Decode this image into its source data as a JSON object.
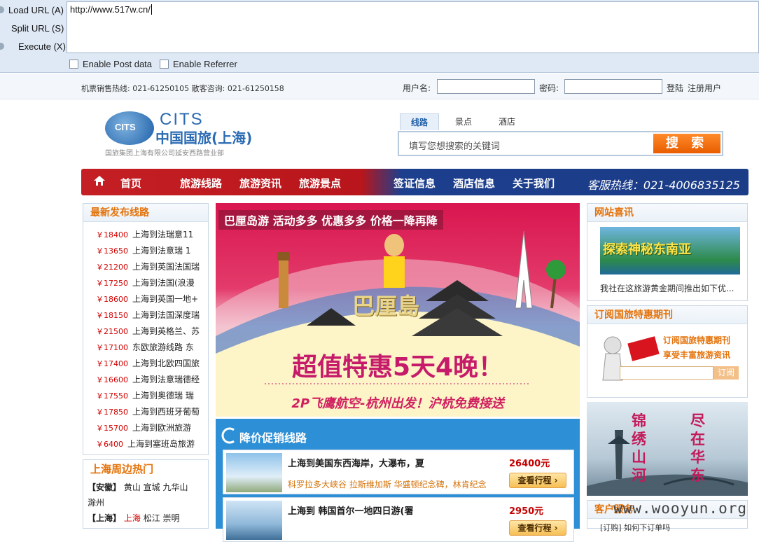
{
  "hackbar": {
    "load_url": "Load URL (A)",
    "split_url": "Split URL (S)",
    "execute": "Execute (X)",
    "url_value": "http://www.517w.cn/",
    "enable_post": "Enable Post data",
    "enable_referrer": "Enable Referrer"
  },
  "topbar": {
    "hotline": "机票销售热线: 021-61250105  散客咨询: 021-61250158",
    "username_label": "用户名:",
    "password_label": "密码:",
    "login": "登陆",
    "register": "注册用户"
  },
  "logo": {
    "globe_text": "CITS",
    "brand_en": "CITS",
    "brand_cn": "中国国旅(上海)",
    "subtitle": "国旅集团上海有限公司延安西路营业部"
  },
  "search": {
    "tabs": [
      "线路",
      "景点",
      "酒店"
    ],
    "placeholder": "填写您想搜索的关键词",
    "button": "搜 索"
  },
  "nav": {
    "items": [
      "首页",
      "旅游线路",
      "旅游资讯",
      "旅游景点",
      "签证信息",
      "酒店信息",
      "关于我们"
    ],
    "hotline": "客服热线：021-4006835125"
  },
  "latest": {
    "title": "最新发布线路",
    "items": [
      {
        "price": "￥18400",
        "name": "上海到法瑞意11"
      },
      {
        "price": "￥13650",
        "name": "上海到法意瑞 1"
      },
      {
        "price": "￥21200",
        "name": "上海到英国法国瑞"
      },
      {
        "price": "￥17250",
        "name": "上海到法国(浪漫"
      },
      {
        "price": "￥18600",
        "name": "上海到英国一地+"
      },
      {
        "price": "￥18150",
        "name": "上海到法国深度瑞"
      },
      {
        "price": "￥21500",
        "name": "上海到英格兰、苏"
      },
      {
        "price": "￥17100",
        "name": "东欧旅游线路 东"
      },
      {
        "price": "￥17400",
        "name": "上海到北欧四国旅"
      },
      {
        "price": "￥16600",
        "name": "上海到法意瑞德经"
      },
      {
        "price": "￥17550",
        "name": "上海到奥德瑞 瑞"
      },
      {
        "price": "￥17850",
        "name": "上海到西班牙葡萄"
      },
      {
        "price": "￥15700",
        "name": "上海到欧洲旅游"
      },
      {
        "price": "￥6400",
        "name": "上海到塞班岛旅游"
      }
    ]
  },
  "nearby": {
    "title": "上海周边热门",
    "line1_tag": "【安徽】",
    "line1": "黄山   宣城 九华山",
    "line2": "滁州",
    "line3_tag": "【上海】",
    "line3_hot": "上海",
    "line3": "松江   崇明"
  },
  "banner": {
    "caption": "巴厘岛游 活动多多 优惠多多 价格一降再降",
    "island": "巴厘島",
    "headline": "超值特惠5天4晚！",
    "subline": "2P飞鹰航空-杭州出发！沪杭免费接送"
  },
  "promo": {
    "title": "降价促销线路",
    "items": [
      {
        "title": "上海到美国东西海岸，大瀑布，夏",
        "sub": "科罗拉多大峡谷 拉斯维加斯 华盛顿纪念碑，林肯纪念",
        "price": "26400元",
        "button": "查看行程 ›"
      },
      {
        "title": "上海到 韩国首尔一地四日游(署",
        "sub": "",
        "price": "2950元",
        "button": "查看行程 ›"
      }
    ]
  },
  "right": {
    "news_title": "网站喜讯",
    "news_img_text": "探索神秘东南亚",
    "news_caption": "我社在这旅游黄金期间推出如下优...",
    "subscribe_title": "订阅国旅特惠期刊",
    "subscribe_line1": "订阅国旅特惠期刊",
    "subscribe_line2": "享受丰富旅游资讯",
    "subscribe_btn": "订阅",
    "ad_left": "锦绣山河",
    "ad_right": "尽在华东",
    "service_title": "客户服务",
    "service_item": "[订购] 如何下订单吗"
  },
  "watermark": "www.wooyun.org"
}
